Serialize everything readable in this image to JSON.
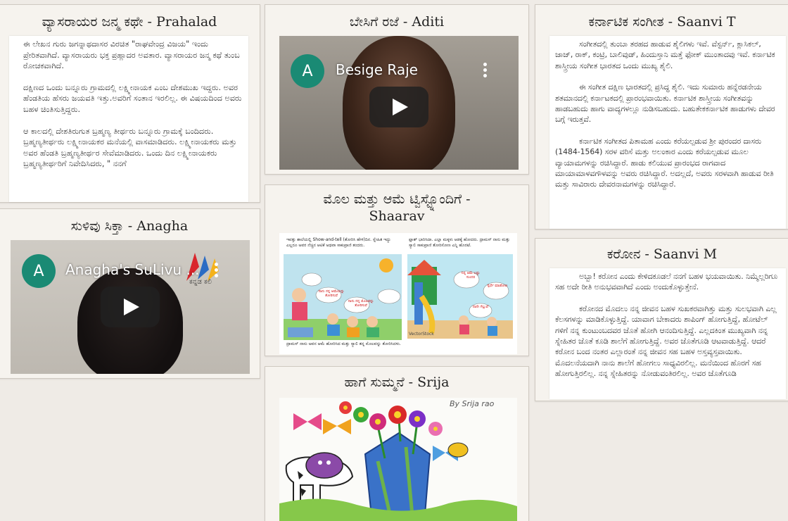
{
  "cards": {
    "prahalad": {
      "title": "ವ್ಯಾಸರಾಯರ ಜನ್ಮ ಕಥೇ - Prahalad",
      "paragraphs": [
        "ಈ ಲೇಖನ ಗುರು ಜಗನ್ನಾಥದಾಸರ ವಿರಚಿತ \"ರಾಘವೇಂದ್ರ ವಿಜಯ\" ಇಂದು ಪ್ರೇರಿತವಾಗಿದೆ. ವ್ಯಾಸರಾಯರು ಭಕ್ತ ಪ್ರಹ್ಲಾದರ ಅವತಾರ. ವ್ಯಾಸರಾಯರ ಜನ್ಮ ಕಥೆ ತುಂಬ ರೋಚಕವಾಗಿದೆ.",
        "ದಕ್ಷಿಣದ ಒಂದು ಬನ್ನೂರು ಗ್ರಾಮದಲ್ಲಿ ಲಕ್ಷ್ಮೀನಾಯಕ ಎಂಬ ದೇಶಮುಖ ಇದ್ದರು. ಅವರ ಹೆಂಡತಿಯ ಹೆಸರು ಜಯವತಿ ಇತ್ತು.ಅವರಿಗೆ ಸಂತಾನ ಇರಲಿಲ್ಲ. ಈ ವಿಷಯದಿಂದ ಅವರು ಬಹಳ ಚಿಂತಿಸುತ್ತಿದ್ದರು.",
        "ಆ ಕಾಲದಲ್ಲಿ ದೇಶತಿರುಗುತ ಬ್ರಹ್ಮಣ್ಯ ತೀರ್ಥರು ಬನ್ನೂರು ಗ್ರಾಮಕ್ಕೆ ಬಂದಿದರು. ಬ್ರಹ್ಮಣ್ಯತೀರ್ಥರು ಲಕ್ಷ್ಮೀನಾಯಕರ ಮನೆಯಲ್ಲಿ ವಾಸಮಾಡಿದರು. ಲಕ್ಷ್ಮೀನಾಯಕರು ಮತ್ತು ಅವರ ಹೆಂಡತಿ ಬ್ರಹ್ಮಣ್ಯತೀರ್ಥರ ಸೇವೆಮಾಡಿದರು. ಒಂದು ದಿನ ಲಕ್ಷ್ಮೀನಾಯಕರು ಬ್ರಹ್ಮಣ್ಯತೀರ್ಥರಿಗೆ ನಿವೇದಿಸಿದರು, \" ನನಗೆ"
      ]
    },
    "anagha": {
      "title": "ಸುಳಿವು ಸಿಕ್ತಾ - Anagha",
      "video_title": "Anagha's SuLivu ...",
      "avatar_letter": "A",
      "watermark": "ಕನ್ನಡ ಕಲಿ"
    },
    "aditi": {
      "title": "ಬೇಸಿಗೆ ರಜೆ - Aditi",
      "video_title": "Besige Raje",
      "avatar_letter": "A"
    },
    "shaarav": {
      "title_line1": "ಮೊಲ ಮತ್ತು ಆಮೆ ಟ್ವಿಸ್ಟ್ನೊಂದಿಗೆ -",
      "title_line2": "Shaarav",
      "caption_left": "ಇವತ್ತು ಶಾಲೆಯಲ್ಲಿ Show-and-tell (ತೋರಿಸಿ ಹೇಳಿ)ದಿನ. ಸ್ನೇಹಿತ ಇದ್ದು ಎಲ್ಲರೂ ಅವರ ನೆಚ್ಚಿನ ಆಟಿಕೆ ಅಥವಾ ಸಾಕುಪ್ರಾಣಿ ತಂದರು.",
      "caption_right": "ಫ್ಲಾಶ್ ಭಾರಿಸಿದಾ. ಎಲ್ಲಾ ಮಕ್ಕಳು ಆಡಕ್ಕೆ ಹೋದರು. ದ್ರಾಮಸ್ ನಾನು ಮತ್ತು ಸ್ಯಾಲಿ ಸಾಕುಪ್ರಾಣಿ ತೋರಿಸೋಣ ಎನ್ನಿ ಹೊರಟೆ.",
      "bubble_1": "ನಾನು ನನ್ನ ಆಮೆಯನ್ನು ತೋರಿಸುವೆ",
      "bubble_2": "ನಾನು ನನ್ನ ಮೊಲವನ್ನು ತೋರಿಸುವೆ",
      "bubble_3": "ನಿನ್ನ ಆಮೆ ಎಷ್ಟು ಸುಂದರ",
      "bubble_4": "ಸ್ಪರ್ಧೆ ಮಾಡೋಣ",
      "bubble_5": "ನಾನೇ ಗೆಲ್ಲುವೆ",
      "watermark": "VectorStock",
      "caption_bottom": "ದ್ರಾಮಸ್ ನಾನು ಅವನ ಆಮೆ ಹೋರಿಸಿದ ಮತ್ತು ಸ್ಯಾಲಿ ತನ್ನ ಮೊಲವನ್ನು ತೋರಿಸಿದಳು."
    },
    "srija": {
      "title": "ಹಾಗೆ ಸುಮ್ಮನೆ - Srija",
      "signature": "By Srija rao"
    },
    "saanvi_t": {
      "title": "ಕರ್ನಾಟಿಕ ಸಂಗೀತ - Saanvi T",
      "paragraphs": [
        "ಸಂಗೀತದಲ್ಲಿ ತುಂಬಾ ತರಹದ ಹಾಡುವ ಶೈಲಿಗಳು ಇವೆ. ವೆಸ್ಟರ್ನ್, ಕ್ಲಾಸಿಕಲ್, ಜಾಜ್, ರಾಕ್, ಕಂಟ್ರಿ, ಬಾಲಿವುಡ್, ಹಿಂದುಸ್ತಾನಿ ಮತ್ತೆ ಫೋಕ್ ಮುಂತಾದವು ಇವೆ. ಕರ್ನಾಟಿಕ ಶಾಸ್ತ್ರೀಯ ಸಂಗೀತ ಭಾರತದ ಒಂದು ಮುಖ್ಯ ಶೈಲಿ.",
        "ಈ ಸಂಗೀತ ದಕ್ಷಿಣ ಭಾರತದಲ್ಲಿ ಪ್ರಸಿದ್ಧ ಶೈಲಿ. ಇದು ಸುಮಾರು ಹನ್ನೆರಡನೇಯ ಶತಮಾನದಲ್ಲಿ ಕರ್ನಾಟಕದಲ್ಲಿ ಪ್ರಾರಂಭವಾಯಿತು. ಕರ್ನಾಟಿಕ ಶಾಸ್ತ್ರೀಯ ಸಂಗೀತವನ್ನು ಹಾಡಬಹುದು ಹಾಗು ವಾದ್ಯಗಳಲ್ಲೂ ನುಡಿಸಬಹುದು. ಬಹುತೇಕಕರ್ನಾಟಿಕ ಹಾಡುಗಳು ದೇವರ ಬಗ್ಗೆ ಇರುತ್ತವೆ.",
        "ಕರ್ನಾಟಿಕ ಸಂಗೀತದ ಪಿತಾಮಹ ಎಂದು ಕರೆಯಲ್ಪಡುವ ಶ್ರೀ ಪುರಂದರ ದಾಸರು (1484-1564) ಸರಳ ವರಿಸೆ ಮತ್ತು ಅಲಂಕಾರ ಎಂದು ಕರೆಯಲ್ಪಡುವ ಮೂಲ ವ್ಯಾಯಾಮಗಳನ್ನು ರಚಿಸಿದ್ದಾರೆ. ಹಾಡು ಕಲಿಯುವ ಪ್ರಾರಂಭದ ರಾಗವಾದ ಮಾಯಾಮಾಳವಗೌಳವನ್ನು ಅವರು ರಚಿಸಿದ್ದಾರೆ. ಅದಲ್ಲದೆ, ಅವರು ಸರಳವಾಗಿ ಹಾಡುವ ರೀತಿ ಮತ್ತು ಸಾವಿರಾರು ದೇವರನಾಮಗಳನ್ನು ರಚಿಸಿದ್ದಾರೆ."
      ]
    },
    "saanvi_m": {
      "title": "ಕರೋನ - Saanvi M",
      "paragraphs": [
        "ಅಬ್ಬಾ! ಕರೋನ ಎಂದು ಕೇಳಿದಕೂಡಲೆ ನನಗೆ ಬಹಳ ಭಯವಾಯಿತು. ನಿಮ್ಮೆಲ್ಲರಿಗೂ ಸಹ ಅದೇ ರೀತಿ ಅನುಭವವಾಗಿದೆ ಎಂದು ಅಂದುಕೊಳ್ಳುತ್ತೇನೆ.",
        "ಕರೋನದ ಮೊದಲು ನನ್ನ ಜೀವನ ಬಹಳ ಸುಖಕರವಾಗಿತ್ತು ಮತ್ತು ಸುಲಭವಾಗಿ ಎಲ್ಲ ಕೆಲಸಗಳನ್ನು ಮಾಡಿಕೊಳ್ಳುತ್ತಿದ್ದೆ. ಯಾವಾಗ ಬೇಕಾದರು ಶಾಪಿಂಗ್ ಹೋಗುತ್ತಿದ್ದೆ, ಹೋಟೆಲ್ ಗಳಿಗೆ ನನ್ನ ಕುಂಟುಂಬದವರ ಜೊತೆ ಹೋಗಿ ಆನಂದಿಸುತ್ತಿದ್ದೆ. ಎಲ್ಲದಕಿಂತ ಮುಖ್ಯವಾಗಿ ನನ್ನ ಸ್ನೇಹಿತರ ಜೊತೆ ಕೂಡಿ ಶಾಲೆಗೆ ಹೋಗುತ್ತಿದ್ದೆ. ಅವರ ಜೊತೆಗೂಡಿ ಆಟವಾಡುತ್ತಿದ್ದೆ. ಆದರೆ ಕರೋನ ಬಂದ ನಂತರ ಎಲ್ಲಾರಂತೆ ನನ್ನ ಜೀವನ ಸಹ ಬಹಳ ಅಸ್ತವ್ಯಸ್ತವಾಯಿತು. ಮೊದಲನೆಯದಾಗಿ ನಾನು ಶಾಲೆಗೆ ಹೋಗಲು ಸಾಧ್ಯವಿರಲಿಲ್ಲ. ಮನೆಯಿಂದ ಹೊರಗೆ ಸಹ ಹೋಗುತ್ತಿರಲಿಲ್ಲ. ನನ್ನ ಸ್ನೇಹಿತರನ್ನು ನೋಡುವಂತಿರಲಿಲ್ಲ. ಅವರ ಜೊತೆಗೂಡಿ"
      ]
    }
  },
  "colors": {
    "page_bg": "#efebe6",
    "card_bg": "#f6f3ee",
    "avatar": "#1a8a74"
  }
}
